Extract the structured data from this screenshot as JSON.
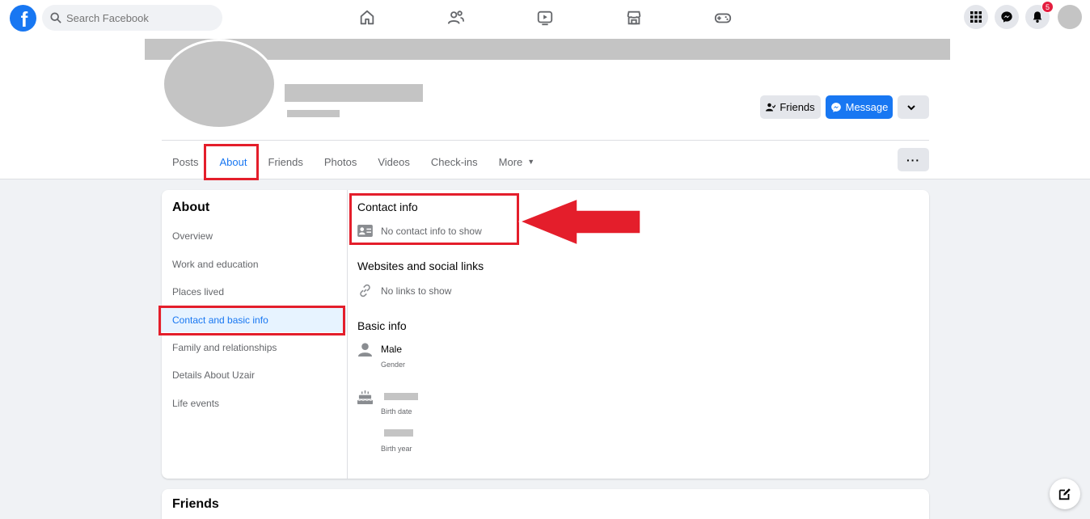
{
  "topbar": {
    "logo_letter": "f",
    "search_placeholder": "Search Facebook",
    "notification_count": "5"
  },
  "profile": {
    "buttons": {
      "friends": "Friends",
      "message": "Message"
    },
    "tabs": [
      {
        "label": "Posts"
      },
      {
        "label": "About"
      },
      {
        "label": "Friends"
      },
      {
        "label": "Photos"
      },
      {
        "label": "Videos"
      },
      {
        "label": "Check-ins"
      },
      {
        "label": "More"
      }
    ],
    "dots": "···"
  },
  "about": {
    "title": "About",
    "sidebar": [
      {
        "label": "Overview"
      },
      {
        "label": "Work and education"
      },
      {
        "label": "Places lived"
      },
      {
        "label": "Contact and basic info"
      },
      {
        "label": "Family and relationships"
      },
      {
        "label": "Details About Uzair"
      },
      {
        "label": "Life events"
      }
    ],
    "contact": {
      "title": "Contact info",
      "empty": "No contact info to show"
    },
    "websites": {
      "title": "Websites and social links",
      "empty": "No links to show"
    },
    "basic": {
      "title": "Basic info",
      "gender_value": "Male",
      "gender_caption": "Gender",
      "birth_date_caption": "Birth date",
      "birth_year_caption": "Birth year"
    }
  },
  "friends_card": {
    "title": "Friends"
  },
  "colors": {
    "accent": "#1877f2",
    "annotation": "#e41e2b"
  }
}
